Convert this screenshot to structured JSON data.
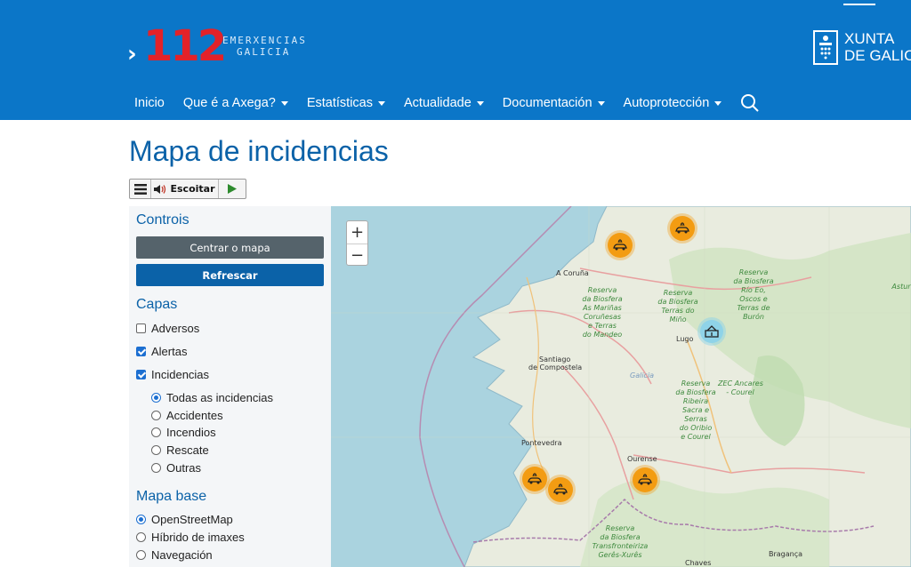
{
  "header": {
    "logo": {
      "number": "112",
      "line1": "EMERXENCIAS",
      "line2": "GALICIA"
    },
    "xunta": {
      "line1": "XUNTA",
      "line2": "DE GALICIA"
    },
    "nav": [
      {
        "label": "Inicio",
        "dropdown": false
      },
      {
        "label": "Que é a Axega?",
        "dropdown": true
      },
      {
        "label": "Estatísticas",
        "dropdown": true
      },
      {
        "label": "Actualidade",
        "dropdown": true
      },
      {
        "label": "Documentación",
        "dropdown": true
      },
      {
        "label": "Autoprotección",
        "dropdown": true
      }
    ],
    "search_icon": "search-icon"
  },
  "page": {
    "title": "Mapa de incidencias"
  },
  "readspeaker": {
    "listen_label": "Escoitar"
  },
  "sidebar": {
    "controls_title": "Controis",
    "center_label": "Centrar o mapa",
    "refresh_label": "Refrescar",
    "layers_title": "Capas",
    "layers": [
      {
        "label": "Adversos",
        "checked": false
      },
      {
        "label": "Alertas",
        "checked": true
      },
      {
        "label": "Incidencias",
        "checked": true
      }
    ],
    "incident_filters": [
      {
        "label": "Todas as incidencias",
        "selected": true
      },
      {
        "label": "Accidentes",
        "selected": false
      },
      {
        "label": "Incendios",
        "selected": false
      },
      {
        "label": "Rescate",
        "selected": false
      },
      {
        "label": "Outras",
        "selected": false
      }
    ],
    "basemap_title": "Mapa base",
    "basemaps": [
      {
        "label": "OpenStreetMap",
        "selected": true
      },
      {
        "label": "Híbrido de imaxes",
        "selected": false
      },
      {
        "label": "Navegación",
        "selected": false
      }
    ]
  },
  "map": {
    "zoom_in": "+",
    "zoom_out": "−",
    "labels": {
      "coruna": "A Coruña",
      "santiago_1": "Santiago",
      "santiago_2": "de Compostela",
      "lugo": "Lugo",
      "ourense": "Ourense",
      "pontevedra": "Pontevedra",
      "galicia": "Galicia",
      "braganca": "Bragança",
      "chaves": "Chaves"
    },
    "reserves": {
      "mariñas": "Reserva\nda Biosfera\nAs Mariñas\nCoruñesas\ne Terras\ndo Mandeo",
      "terras_mino": "Reserva\nda Biosfera\nTerras do\nMiño",
      "rio_eo": "Reserva\nda Biosfera\nRío Eo,\nOscos e\nTerras de\nBurón",
      "ribeira_sacra": "Reserva\nda Biosfera\nRibeira\nSacra e\nSerras\ndo Oribio\ne Courel",
      "zec": "ZEC Ancares\n- Courel",
      "geres": "Reserva\nda Biosfera\nTransfronteiriza\nGerês-Xurês",
      "asturias": "Astur"
    },
    "markers": {
      "incident_icon": "vehicle-accident-icon",
      "other_icon": "incident-other-icon"
    }
  }
}
